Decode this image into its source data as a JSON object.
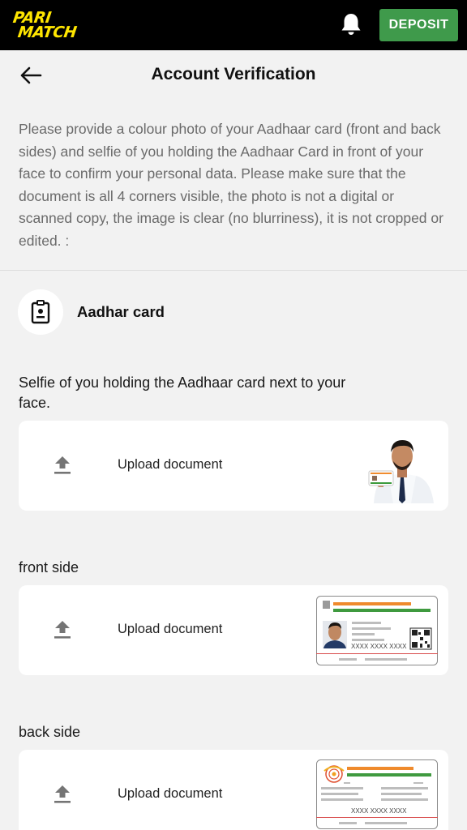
{
  "topbar": {
    "logo_line1": "PARI",
    "logo_line2": "MATCH",
    "brand_color": "#ffe600",
    "deposit_label": "DEPOSIT",
    "deposit_color": "#3f9a4b"
  },
  "header": {
    "title": "Account Verification"
  },
  "intro": "Please provide a colour photo of your Aadhaar card (front and back sides) and selfie of you holding the Aadhaar Card in front of your face to confirm your personal data. Please make sure that the document is all 4 corners visible, the photo is not a digital or scanned copy, the image is clear (no blurriness), it is not cropped or edited. :",
  "document_type": {
    "icon": "id-card-icon",
    "label": "Aadhar card"
  },
  "sections": [
    {
      "label": "Selfie of you holding the Aadhaar card next to your face.",
      "upload_label": "Upload document",
      "icon": "upload-icon",
      "example": "selfie-with-card"
    },
    {
      "label": "front side",
      "upload_label": "Upload document",
      "icon": "upload-icon",
      "example": "aadhaar-front",
      "sample_number": "XXXX XXXX XXXX"
    },
    {
      "label": "back side",
      "upload_label": "Upload document",
      "icon": "upload-icon",
      "example": "aadhaar-back",
      "sample_number": "XXXX XXXX XXXX"
    }
  ]
}
